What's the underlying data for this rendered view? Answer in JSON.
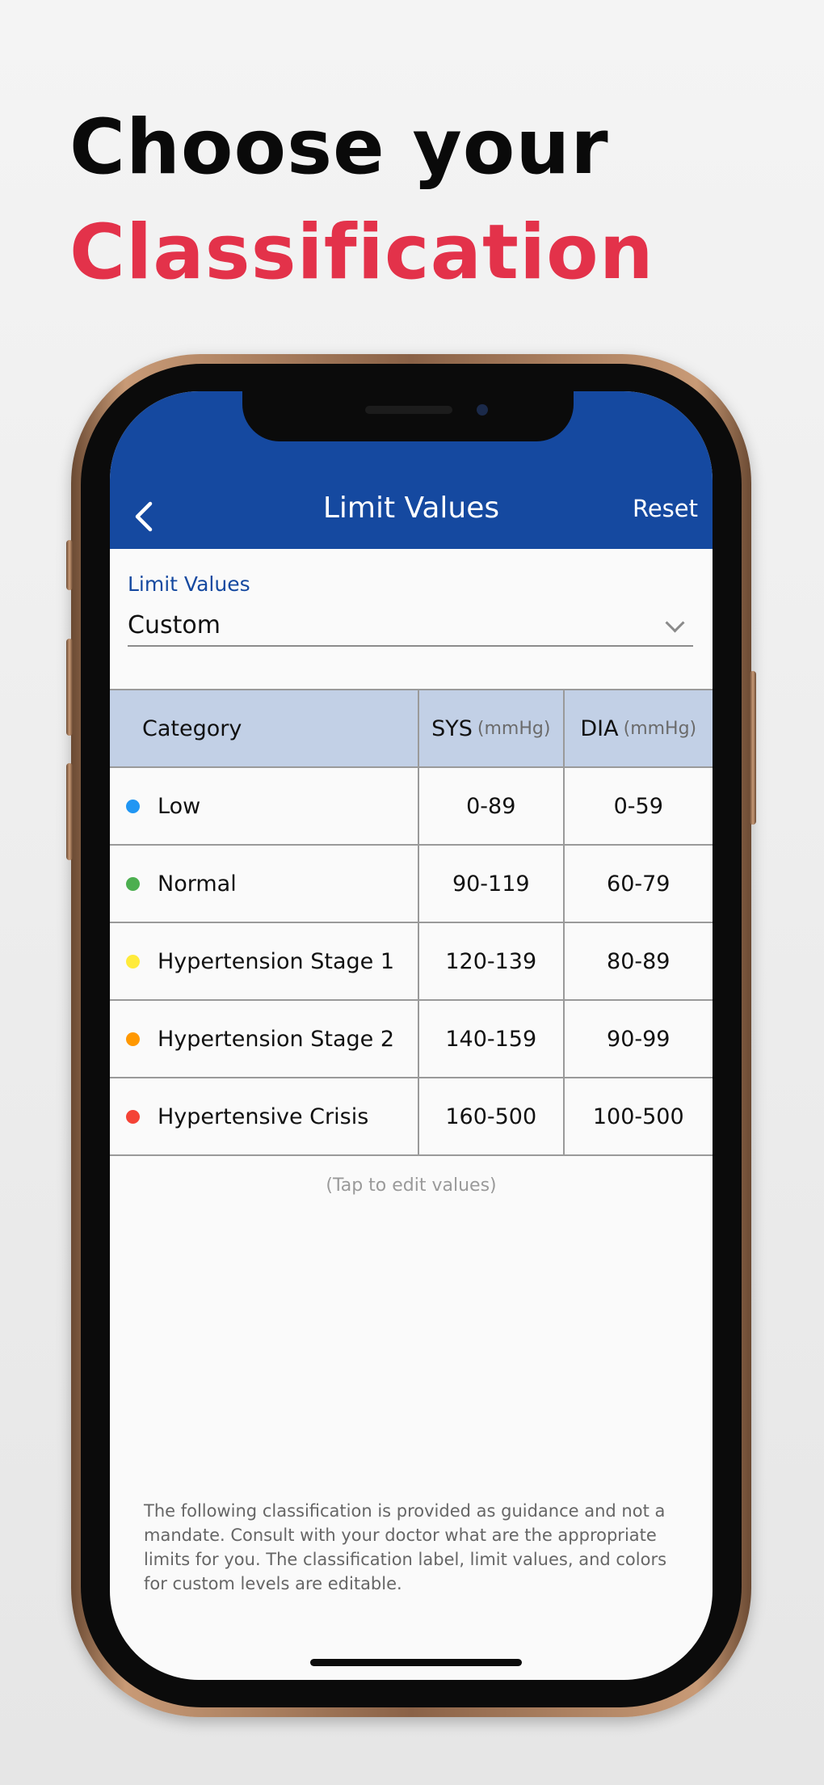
{
  "headline": {
    "line1": "Choose your",
    "line2": "Classification"
  },
  "colors": {
    "accent_red": "#e3324a",
    "navbar_blue": "#1549a0",
    "table_header_bg": "#c2d0e6"
  },
  "navbar": {
    "back_icon": "chevron-left-icon",
    "title": "Limit Values",
    "reset_label": "Reset"
  },
  "limit_values": {
    "label": "Limit Values",
    "selected": "Custom",
    "dropdown_icon": "chevron-down-icon"
  },
  "table": {
    "headers": {
      "category": "Category",
      "sys": "SYS",
      "sys_unit": "(mmHg)",
      "dia": "DIA",
      "dia_unit": "(mmHg)"
    },
    "rows": [
      {
        "category": "Low",
        "sys": "0-89",
        "dia": "0-59",
        "color": "#2196f3"
      },
      {
        "category": "Normal",
        "sys": "90-119",
        "dia": "60-79",
        "color": "#4caf50"
      },
      {
        "category": "Hypertension Stage 1",
        "sys": "120-139",
        "dia": "80-89",
        "color": "#ffeb3b"
      },
      {
        "category": "Hypertension Stage 2",
        "sys": "140-159",
        "dia": "90-99",
        "color": "#ff9800"
      },
      {
        "category": "Hypertensive Crisis",
        "sys": "160-500",
        "dia": "100-500",
        "color": "#f44336"
      }
    ]
  },
  "tap_hint": "(Tap to edit values)",
  "disclaimer": "The following classification is provided as guidance and not a mandate. Consult with your doctor what are the appropriate limits for you. The classification label, limit values, and colors for custom levels are editable."
}
